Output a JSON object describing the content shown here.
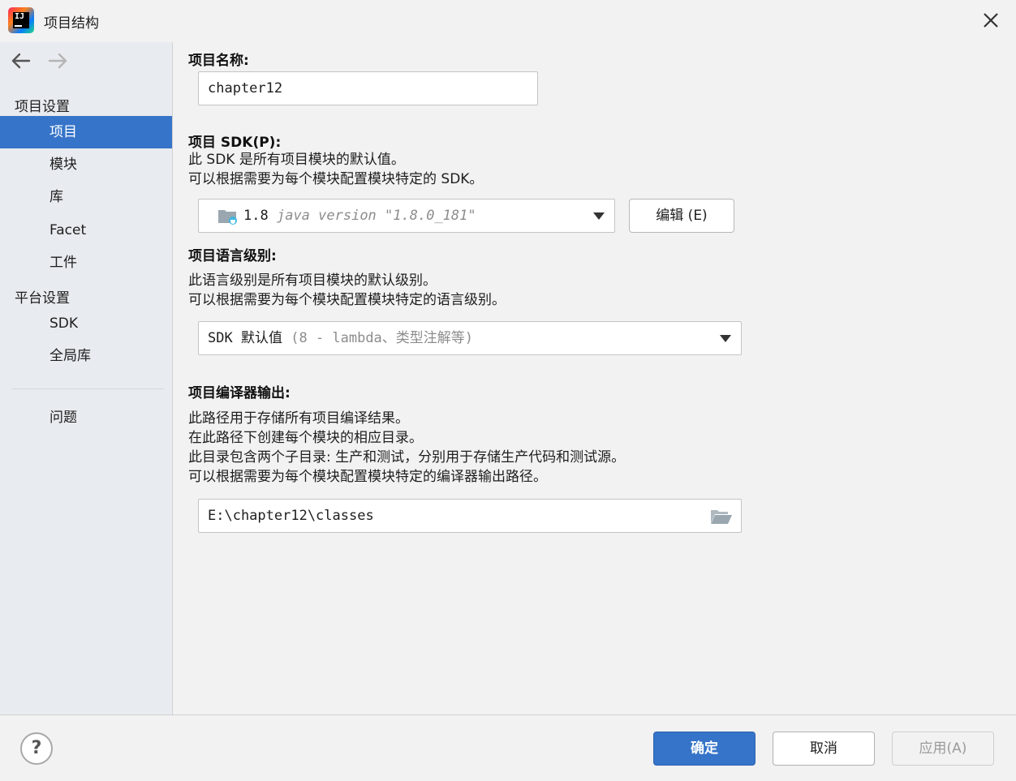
{
  "window": {
    "title": "项目结构",
    "icons": {
      "app": "intellij-idea-logo",
      "close": "close-icon"
    }
  },
  "sidebar": {
    "nav": {
      "back": "arrow-left-icon",
      "forward": "arrow-right-icon"
    },
    "project_settings_header": "项目设置",
    "project_settings_items": [
      "项目",
      "模块",
      "库",
      "Facet",
      "工件"
    ],
    "platform_settings_header": "平台设置",
    "platform_settings_items": [
      "SDK",
      "全局库"
    ],
    "problems": "问题",
    "selected": "项目"
  },
  "main": {
    "project_name": {
      "label": "项目名称:",
      "value": "chapter12"
    },
    "project_sdk": {
      "label": "项目 SDK(P):",
      "desc_line1": "此 SDK 是所有项目模块的默认值。",
      "desc_line2": "可以根据需要为每个模块配置模块特定的 SDK。",
      "selected_version": "1.8",
      "selected_detail": "java version \"1.8.0_181\"",
      "icon": "java-sdk-folder-icon",
      "edit_button": "编辑 (E)"
    },
    "language_level": {
      "label": "项目语言级别:",
      "desc_line1": "此语言级别是所有项目模块的默认级别。",
      "desc_line2": "可以根据需要为每个模块配置模块特定的语言级别。",
      "selected_value": "SDK 默认值",
      "selected_detail": "(8 - lambda、类型注解等)"
    },
    "compiler_output": {
      "label": "项目编译器输出:",
      "desc_line1": "此路径用于存储所有项目编译结果。",
      "desc_line2": "在此路径下创建每个模块的相应目录。",
      "desc_line3": "此目录包含两个子目录: 生产和测试，分别用于存储生产代码和测试源。",
      "desc_line4": "可以根据需要为每个模块配置模块特定的编译器输出路径。",
      "value": "E:\\chapter12\\classes",
      "browse_icon": "folder-open-icon"
    }
  },
  "footer": {
    "help": "?",
    "ok": "确定",
    "cancel": "取消",
    "apply": "应用(A)"
  },
  "colors": {
    "accent": "#3574c9",
    "sidebar_bg": "#e8ebef",
    "panel_bg": "#f2f2f2"
  }
}
